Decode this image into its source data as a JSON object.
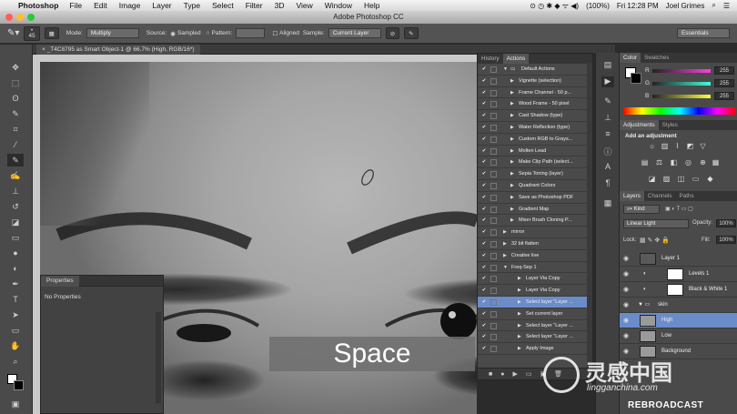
{
  "menubar": {
    "app": "Photoshop",
    "items": [
      "File",
      "Edit",
      "Image",
      "Layer",
      "Type",
      "Select",
      "Filter",
      "3D",
      "View",
      "Window",
      "Help"
    ],
    "battery": "(100%)",
    "clock": "Fri 12:28 PM",
    "user": "Joel Grimes"
  },
  "window": {
    "title": "Adobe Photoshop CC"
  },
  "options": {
    "brush_size": "45",
    "mode_label": "Mode:",
    "mode_value": "Multiply",
    "source_label": "Source:",
    "sampled_label": "Sampled",
    "pattern_label": "Pattern:",
    "aligned_label": "Aligned",
    "sample_label": "Sample:",
    "sample_value": "Current Layer",
    "workspace": "Essentials"
  },
  "document": {
    "tab_title": "_T4C8795 as Smart Object-1 @ 66.7% (High, RGB/16*)",
    "overlay_text": "Space"
  },
  "properties": {
    "tab": "Properties",
    "empty_text": "No Properties"
  },
  "actions": {
    "tabs": [
      "History",
      "Actions"
    ],
    "items": [
      {
        "label": "Default Actions",
        "indent": 0,
        "folder": true,
        "expanded": true
      },
      {
        "label": "Vignette (selection)",
        "indent": 1
      },
      {
        "label": "Frame Channel - 50 p...",
        "indent": 1
      },
      {
        "label": "Wood Frame - 50 pixel",
        "indent": 1
      },
      {
        "label": "Cast Shadow (type)",
        "indent": 1
      },
      {
        "label": "Water Reflection (type)",
        "indent": 1
      },
      {
        "label": "Custom RGB to Grays...",
        "indent": 1
      },
      {
        "label": "Molten Lead",
        "indent": 1
      },
      {
        "label": "Make Clip Path (select...",
        "indent": 1
      },
      {
        "label": "Sepia Toning (layer)",
        "indent": 1
      },
      {
        "label": "Quadrant Colors",
        "indent": 1
      },
      {
        "label": "Save as Photoshop PDF",
        "indent": 1
      },
      {
        "label": "Gradient Map",
        "indent": 1
      },
      {
        "label": "Mixer Brush Cloning P...",
        "indent": 1
      },
      {
        "label": "mirror",
        "indent": 0
      },
      {
        "label": "32 bit flatten",
        "indent": 0
      },
      {
        "label": "Creative live",
        "indent": 0
      },
      {
        "label": "Freq-Sep 1",
        "indent": 0,
        "expanded": true
      },
      {
        "label": "Layer Via Copy",
        "indent": 2
      },
      {
        "label": "Layer Via Copy",
        "indent": 2
      },
      {
        "label": "Select layer \"Layer ...",
        "indent": 2,
        "selected": true
      },
      {
        "label": "Set current layer",
        "indent": 2
      },
      {
        "label": "Select layer \"Layer ...",
        "indent": 2
      },
      {
        "label": "Select layer \"Layer ...",
        "indent": 2
      },
      {
        "label": "Apply Image",
        "indent": 2
      }
    ]
  },
  "color": {
    "tabs": [
      "Color",
      "Swatches"
    ],
    "channels": [
      {
        "label": "R",
        "value": "255",
        "gradient": "#ff3fe0"
      },
      {
        "label": "G",
        "value": "255",
        "gradient": "#40ffd8"
      },
      {
        "label": "B",
        "value": "255",
        "gradient": "#ffff40"
      }
    ]
  },
  "adjustments": {
    "tabs": [
      "Adjustments",
      "Styles"
    ],
    "heading": "Add an adjustment"
  },
  "layers": {
    "tabs": [
      "Layers",
      "Channels",
      "Paths"
    ],
    "kind": "Kind",
    "blend_mode": "Linear Light",
    "opacity_label": "Opacity:",
    "opacity_value": "100%",
    "lock_label": "Lock:",
    "fill_label": "Fill:",
    "fill_value": "100%",
    "rows": [
      {
        "name": "Layer 1",
        "thumb": "#5a5a5a"
      },
      {
        "name": "Levels 1",
        "thumb": "#ffffff",
        "adj": true
      },
      {
        "name": "Black & White 1",
        "thumb": "#ffffff",
        "adj": true
      },
      {
        "name": "skin",
        "group": true
      },
      {
        "name": "High",
        "thumb": "#9a9a9a",
        "selected": true
      },
      {
        "name": "Low",
        "thumb": "#9a9a9a"
      },
      {
        "name": "Background",
        "thumb": "#9a9a9a"
      }
    ]
  },
  "watermark": {
    "brand_cn": "灵感中国",
    "brand_url": "lingganchina.com",
    "rebroadcast": "REBROADCAST"
  }
}
